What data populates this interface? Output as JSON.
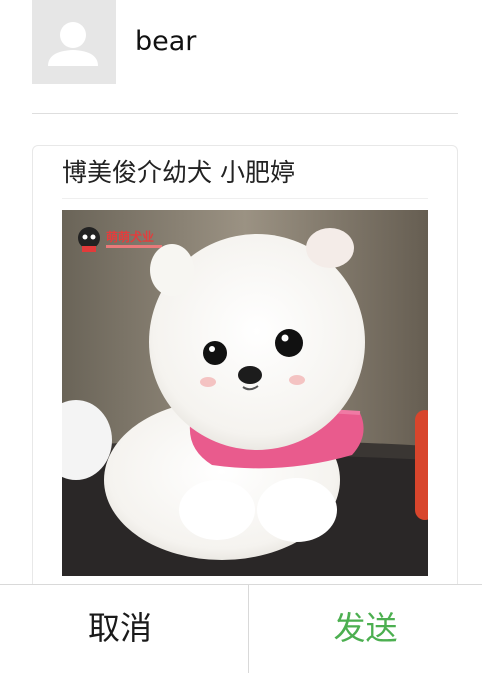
{
  "user": {
    "name": "bear"
  },
  "share_card": {
    "title": "博美俊介幼犬 小肥婷",
    "image_watermark": "萌萌犬业",
    "image_subject": "white pomeranian puppy in pink vest"
  },
  "actions": {
    "cancel_label": "取消",
    "send_label": "发送"
  },
  "colors": {
    "send_accent": "#4caf50",
    "avatar_bg": "#e6e6e6",
    "divider": "#dedede"
  }
}
